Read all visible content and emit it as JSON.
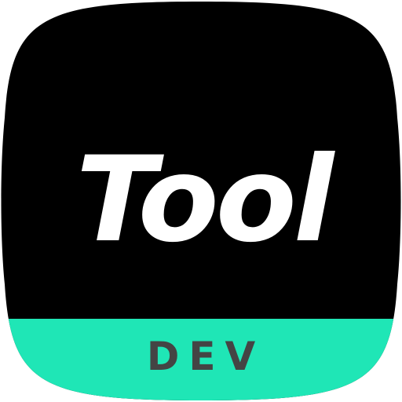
{
  "icon": {
    "title": "Tool",
    "badge": "DEV"
  },
  "colors": {
    "background": "#000000",
    "title": "#ffffff",
    "band": "#1fe6b6",
    "badge_text": "#444444"
  }
}
